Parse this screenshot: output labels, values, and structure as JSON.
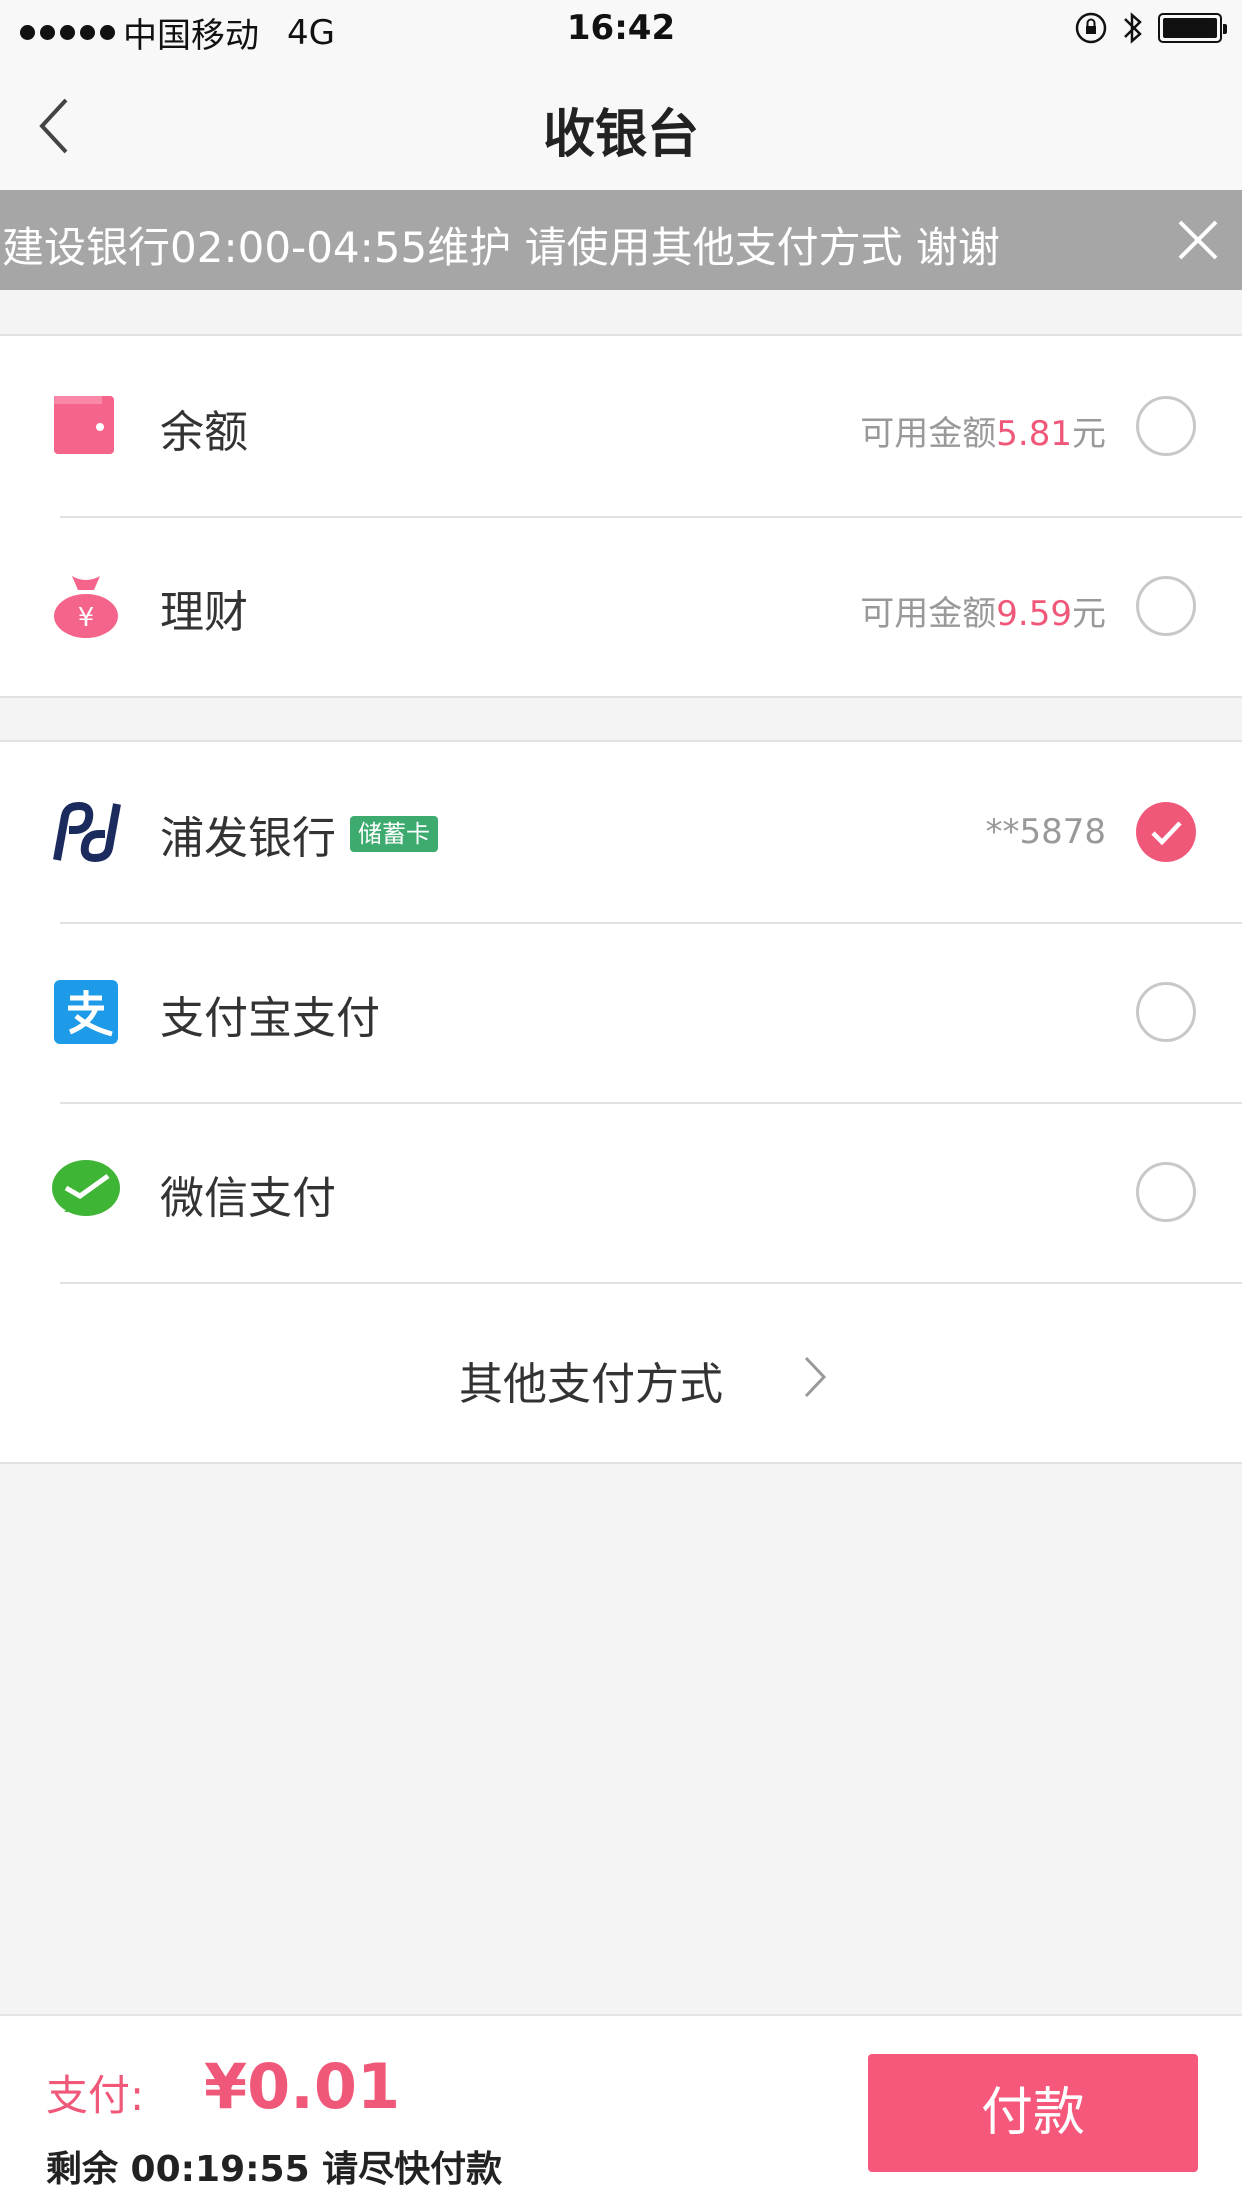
{
  "status_bar": {
    "carrier": "中国移动",
    "network": "4G",
    "time": "16:42"
  },
  "nav": {
    "title": "收银台"
  },
  "notice": {
    "text": "建设银行02:00-04:55维护 请使用其他支付方式 谢谢"
  },
  "wallet_group": [
    {
      "label": "余额",
      "info_prefix": "可用金额",
      "amount": "5.81",
      "info_suffix": "元",
      "checked": false
    },
    {
      "label": "理财",
      "info_prefix": "可用金额",
      "amount": "9.59",
      "info_suffix": "元",
      "checked": false
    }
  ],
  "pay_group": [
    {
      "label": "浦发银行",
      "tag": "储蓄卡",
      "info": "**5878",
      "checked": true
    },
    {
      "label": "支付宝支付",
      "checked": false
    },
    {
      "label": "微信支付",
      "checked": false
    }
  ],
  "more_methods": {
    "label": "其他支付方式"
  },
  "bottom": {
    "pay_label": "支付:",
    "pay_amount": "¥0.01",
    "remaining": "剩余 00:19:55 请尽快付款",
    "pay_button": "付款"
  },
  "colors": {
    "accent": "#f0587a",
    "notice_bg": "#a6a6a6",
    "tag_bg": "#3dab6e",
    "alipay_blue": "#1e9be8",
    "wechat_green": "#3fb536",
    "spd_navy": "#1b2b5e"
  }
}
